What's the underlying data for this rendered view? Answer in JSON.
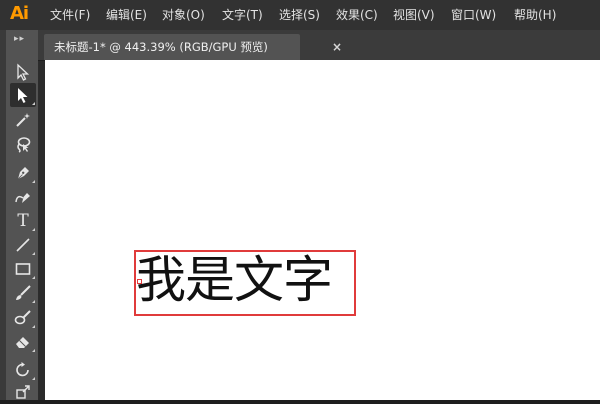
{
  "app": {
    "logo": "Ai",
    "accent_color": "#ff9a00"
  },
  "menu": [
    {
      "label": "文件(F)"
    },
    {
      "label": "编辑(E)"
    },
    {
      "label": "对象(O)"
    },
    {
      "label": "文字(T)"
    },
    {
      "label": "选择(S)"
    },
    {
      "label": "效果(C)"
    },
    {
      "label": "视图(V)"
    },
    {
      "label": "窗口(W)"
    },
    {
      "label": "帮助(H)"
    }
  ],
  "document_tab": {
    "title": "未标题-1* @ 443.39% (RGB/GPU 预览)",
    "close_label": "×"
  },
  "toolbar": {
    "grip": "▸▸",
    "tools": [
      {
        "name": "selection-tool",
        "icon": "arrow-outline-icon"
      },
      {
        "name": "direct-selection-tool",
        "icon": "arrow-filled-icon",
        "active": true
      },
      {
        "name": "magic-wand-tool",
        "icon": "magic-wand-icon"
      },
      {
        "name": "lasso-tool",
        "icon": "lasso-icon"
      },
      {
        "name": "pen-tool",
        "icon": "pen-icon"
      },
      {
        "name": "curvature-tool",
        "icon": "curvature-pen-icon"
      },
      {
        "name": "type-tool",
        "icon": "type-icon",
        "glyph": "T"
      },
      {
        "name": "line-tool",
        "icon": "line-icon"
      },
      {
        "name": "rectangle-tool",
        "icon": "rectangle-icon"
      },
      {
        "name": "paintbrush-tool",
        "icon": "paintbrush-icon"
      },
      {
        "name": "blob-brush-tool",
        "icon": "blob-brush-icon"
      },
      {
        "name": "eraser-tool",
        "icon": "eraser-icon"
      },
      {
        "name": "rotate-tool",
        "icon": "rotate-icon"
      },
      {
        "name": "scale-tool",
        "icon": "scale-icon"
      }
    ]
  },
  "canvas": {
    "text_content": "我是文字",
    "highlight_color": "#e03b3b"
  }
}
